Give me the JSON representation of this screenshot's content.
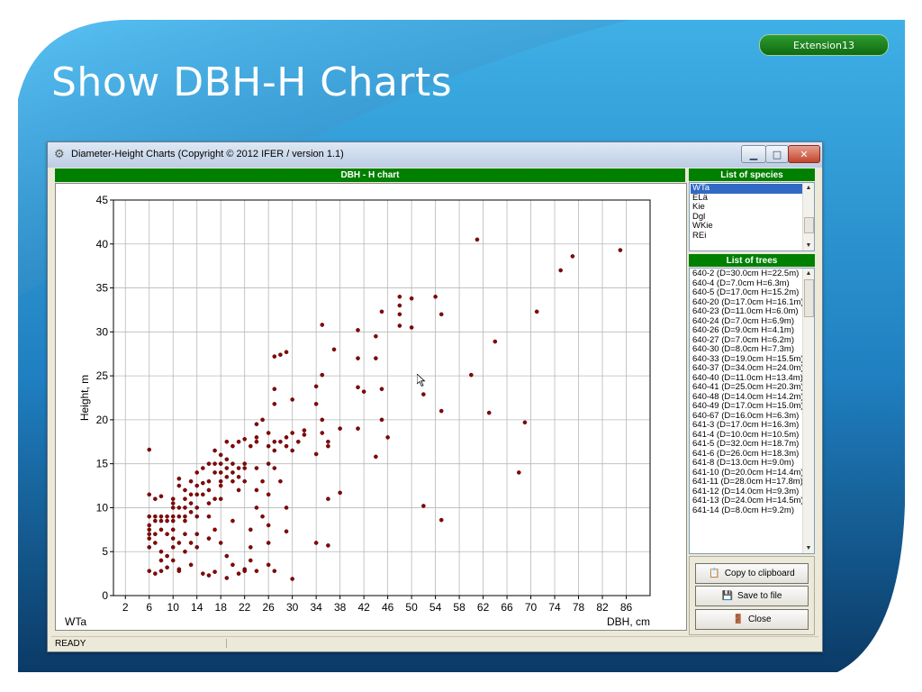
{
  "slide": {
    "title": "Show DBH-H Charts",
    "badge": "Extension13",
    "colors": {
      "bg_light": "#3aa7df",
      "bg_dark": "#0a3a62",
      "badge": "#1f8a22",
      "header_green": "#008000",
      "point": "#8b0000"
    }
  },
  "window": {
    "title": "Diameter-Height Charts (Copyright © 2012 IFER / version 1.1)",
    "icons": {
      "app": "gear-icon",
      "minimize": "minimize-icon",
      "maximize": "maximize-icon",
      "close": "close-icon"
    },
    "status": "READY"
  },
  "chart_data": {
    "type": "scatter",
    "title": "DBH - H chart",
    "xlabel": "DBH, cm",
    "ylabel": "Height, m",
    "series_label": "WTa",
    "xlim": [
      0,
      90
    ],
    "ylim": [
      0,
      45
    ],
    "xticks": [
      2,
      6,
      10,
      14,
      18,
      22,
      26,
      30,
      34,
      38,
      42,
      46,
      50,
      54,
      58,
      62,
      66,
      70,
      74,
      78,
      82,
      86
    ],
    "yticks": [
      0,
      5,
      10,
      15,
      20,
      25,
      30,
      35,
      40,
      45
    ],
    "grid": true,
    "points": [
      [
        6,
        16.6
      ],
      [
        6,
        11.5
      ],
      [
        6,
        9
      ],
      [
        6,
        8
      ],
      [
        6,
        7
      ],
      [
        6,
        6.5
      ],
      [
        6,
        5.5
      ],
      [
        6,
        2.8
      ],
      [
        6,
        7.5
      ],
      [
        7,
        9
      ],
      [
        7,
        8.5
      ],
      [
        7,
        7
      ],
      [
        7,
        6
      ],
      [
        7,
        2.5
      ],
      [
        7,
        11
      ],
      [
        8,
        9
      ],
      [
        8,
        8.5
      ],
      [
        8,
        7.5
      ],
      [
        8,
        5
      ],
      [
        8,
        4
      ],
      [
        8,
        2.8
      ],
      [
        8,
        11.3
      ],
      [
        9,
        9
      ],
      [
        9,
        8.5
      ],
      [
        9,
        7
      ],
      [
        9,
        4.5
      ],
      [
        9,
        3.2
      ],
      [
        10,
        11
      ],
      [
        10,
        10.5
      ],
      [
        10,
        10
      ],
      [
        10,
        9
      ],
      [
        10,
        8.5
      ],
      [
        10,
        7.5
      ],
      [
        10,
        6.5
      ],
      [
        10,
        5.5
      ],
      [
        10,
        4
      ],
      [
        11,
        13.3
      ],
      [
        11,
        12.5
      ],
      [
        11,
        10
      ],
      [
        11,
        9
      ],
      [
        11,
        6
      ],
      [
        11,
        3
      ],
      [
        11,
        2.8
      ],
      [
        12,
        12
      ],
      [
        12,
        11
      ],
      [
        12,
        10
      ],
      [
        12,
        9
      ],
      [
        12,
        8.5
      ],
      [
        12,
        7
      ],
      [
        12,
        5
      ],
      [
        13,
        13
      ],
      [
        13,
        11.5
      ],
      [
        13,
        10.5
      ],
      [
        13,
        9.5
      ],
      [
        13,
        6
      ],
      [
        13,
        3.5
      ],
      [
        14,
        14
      ],
      [
        14,
        12.5
      ],
      [
        14,
        11.5
      ],
      [
        14,
        10
      ],
      [
        14,
        9
      ],
      [
        14,
        7
      ],
      [
        14,
        5.5
      ],
      [
        15,
        14.5
      ],
      [
        15,
        12.8
      ],
      [
        15,
        11.5
      ],
      [
        15,
        2.5
      ],
      [
        16,
        15
      ],
      [
        16,
        13
      ],
      [
        16,
        12
      ],
      [
        16,
        10.5
      ],
      [
        16,
        9
      ],
      [
        16,
        6.5
      ],
      [
        16,
        2.3
      ],
      [
        17,
        16.5
      ],
      [
        17,
        15
      ],
      [
        17,
        14
      ],
      [
        17,
        11
      ],
      [
        17,
        7.5
      ],
      [
        17,
        2.7
      ],
      [
        18,
        16
      ],
      [
        18,
        15
      ],
      [
        18,
        14
      ],
      [
        18,
        13
      ],
      [
        18,
        12.5
      ],
      [
        18,
        11
      ],
      [
        18,
        6
      ],
      [
        19,
        17.5
      ],
      [
        19,
        15.5
      ],
      [
        19,
        14.5
      ],
      [
        19,
        13.5
      ],
      [
        19,
        4.5
      ],
      [
        19,
        2
      ],
      [
        20,
        17
      ],
      [
        20,
        15
      ],
      [
        20,
        14
      ],
      [
        20,
        13
      ],
      [
        20,
        8.5
      ],
      [
        20,
        3.5
      ],
      [
        21,
        17.5
      ],
      [
        21,
        14.5
      ],
      [
        21,
        13.5
      ],
      [
        21,
        12
      ],
      [
        21,
        2.5
      ],
      [
        22,
        17.8
      ],
      [
        22,
        15
      ],
      [
        22,
        14.5
      ],
      [
        22,
        13
      ],
      [
        22,
        3
      ],
      [
        22,
        2.8
      ],
      [
        23,
        17
      ],
      [
        23,
        5.5
      ],
      [
        23,
        7.5
      ],
      [
        23,
        4
      ],
      [
        24,
        19.5
      ],
      [
        24,
        18
      ],
      [
        24,
        17.5
      ],
      [
        24,
        14.5
      ],
      [
        24,
        12
      ],
      [
        24,
        10
      ],
      [
        24,
        2.8
      ],
      [
        25,
        20
      ],
      [
        25,
        13
      ],
      [
        25,
        9
      ],
      [
        26,
        18.5
      ],
      [
        26,
        17
      ],
      [
        26,
        15
      ],
      [
        26,
        11.5
      ],
      [
        26,
        8
      ],
      [
        26,
        6
      ],
      [
        26,
        3.5
      ],
      [
        27,
        27.2
      ],
      [
        27,
        23.5
      ],
      [
        27,
        21.8
      ],
      [
        27,
        17.5
      ],
      [
        27,
        16.5
      ],
      [
        27,
        14.5
      ],
      [
        27,
        2.8
      ],
      [
        28,
        27.4
      ],
      [
        28,
        17.5
      ],
      [
        28,
        13
      ],
      [
        29,
        27.7
      ],
      [
        29,
        18
      ],
      [
        29,
        17
      ],
      [
        29,
        10
      ],
      [
        29,
        7.3
      ],
      [
        30,
        22.3
      ],
      [
        30,
        18.5
      ],
      [
        30,
        16.5
      ],
      [
        30,
        1.9
      ],
      [
        31,
        17.5
      ],
      [
        32,
        18.8
      ],
      [
        32,
        18.3
      ],
      [
        34,
        23.8
      ],
      [
        34,
        21.8
      ],
      [
        34,
        16.1
      ],
      [
        34,
        6
      ],
      [
        35,
        30.8
      ],
      [
        35,
        25.1
      ],
      [
        35,
        20
      ],
      [
        35,
        18.5
      ],
      [
        36,
        17.5
      ],
      [
        36,
        17
      ],
      [
        36,
        11
      ],
      [
        36,
        5.7
      ],
      [
        37,
        28
      ],
      [
        38,
        19
      ],
      [
        38,
        11.7
      ],
      [
        41,
        30.2
      ],
      [
        41,
        27
      ],
      [
        41,
        23.7
      ],
      [
        41,
        19
      ],
      [
        42,
        23.2
      ],
      [
        44,
        29.5
      ],
      [
        44,
        27
      ],
      [
        44,
        15.8
      ],
      [
        45,
        32.3
      ],
      [
        45,
        23.5
      ],
      [
        45,
        20
      ],
      [
        46,
        18
      ],
      [
        48,
        34
      ],
      [
        48,
        33
      ],
      [
        48,
        32
      ],
      [
        48,
        30.7
      ],
      [
        50,
        33.8
      ],
      [
        50,
        30.5
      ],
      [
        52,
        22.9
      ],
      [
        52,
        10.2
      ],
      [
        54,
        34
      ],
      [
        55,
        32
      ],
      [
        55,
        21
      ],
      [
        55,
        8.6
      ],
      [
        60,
        25.1
      ],
      [
        61,
        40.5
      ],
      [
        63,
        20.8
      ],
      [
        64,
        28.9
      ],
      [
        68,
        14
      ],
      [
        69,
        19.7
      ],
      [
        71,
        32.3
      ],
      [
        75,
        37
      ],
      [
        77,
        38.6
      ],
      [
        85,
        39.3
      ]
    ]
  },
  "species": {
    "header": "List of species",
    "items": [
      "WTa",
      "ELä",
      "Kie",
      "Dgl",
      "WKie",
      "REi"
    ],
    "selected_index": 0
  },
  "trees": {
    "header": "List of trees",
    "items": [
      "640-2 (D=30.0cm H=22.5m)",
      "640-4 (D=7.0cm H=6.3m)",
      "640-5 (D=17.0cm H=15.2m)",
      "640-20 (D=17.0cm H=16.1m)",
      "640-23 (D=11.0cm H=6.0m)",
      "640-24 (D=7.0cm H=6.9m)",
      "640-26 (D=9.0cm H=4.1m)",
      "640-27 (D=7.0cm H=6.2m)",
      "640-30 (D=8.0cm H=7.3m)",
      "640-33 (D=19.0cm H=15.5m)",
      "640-37 (D=34.0cm H=24.0m)",
      "640-40 (D=11.0cm H=13.4m)",
      "640-41 (D=25.0cm H=20.3m)",
      "640-48 (D=14.0cm H=14.2m)",
      "640-49 (D=17.0cm H=15.0m)",
      "640-67 (D=16.0cm H=6.3m)",
      "641-3 (D=17.0cm H=16.3m)",
      "641-4 (D=10.0cm H=10.5m)",
      "641-5 (D=32.0cm H=18.7m)",
      "641-6 (D=26.0cm H=18.3m)",
      "641-8 (D=13.0cm H=9.0m)",
      "641-10 (D=20.0cm H=14.4m)",
      "641-11 (D=28.0cm H=17.8m)",
      "641-12 (D=14.0cm H=9.3m)",
      "641-13 (D=24.0cm H=14.5m)",
      "641-14 (D=8.0cm H=9.2m)"
    ]
  },
  "buttons": {
    "copy": "Copy to clipboard",
    "save": "Save to file",
    "close": "Close",
    "icons": {
      "copy": "clipboard-icon",
      "save": "floppy-disk-icon",
      "close": "door-icon"
    }
  }
}
